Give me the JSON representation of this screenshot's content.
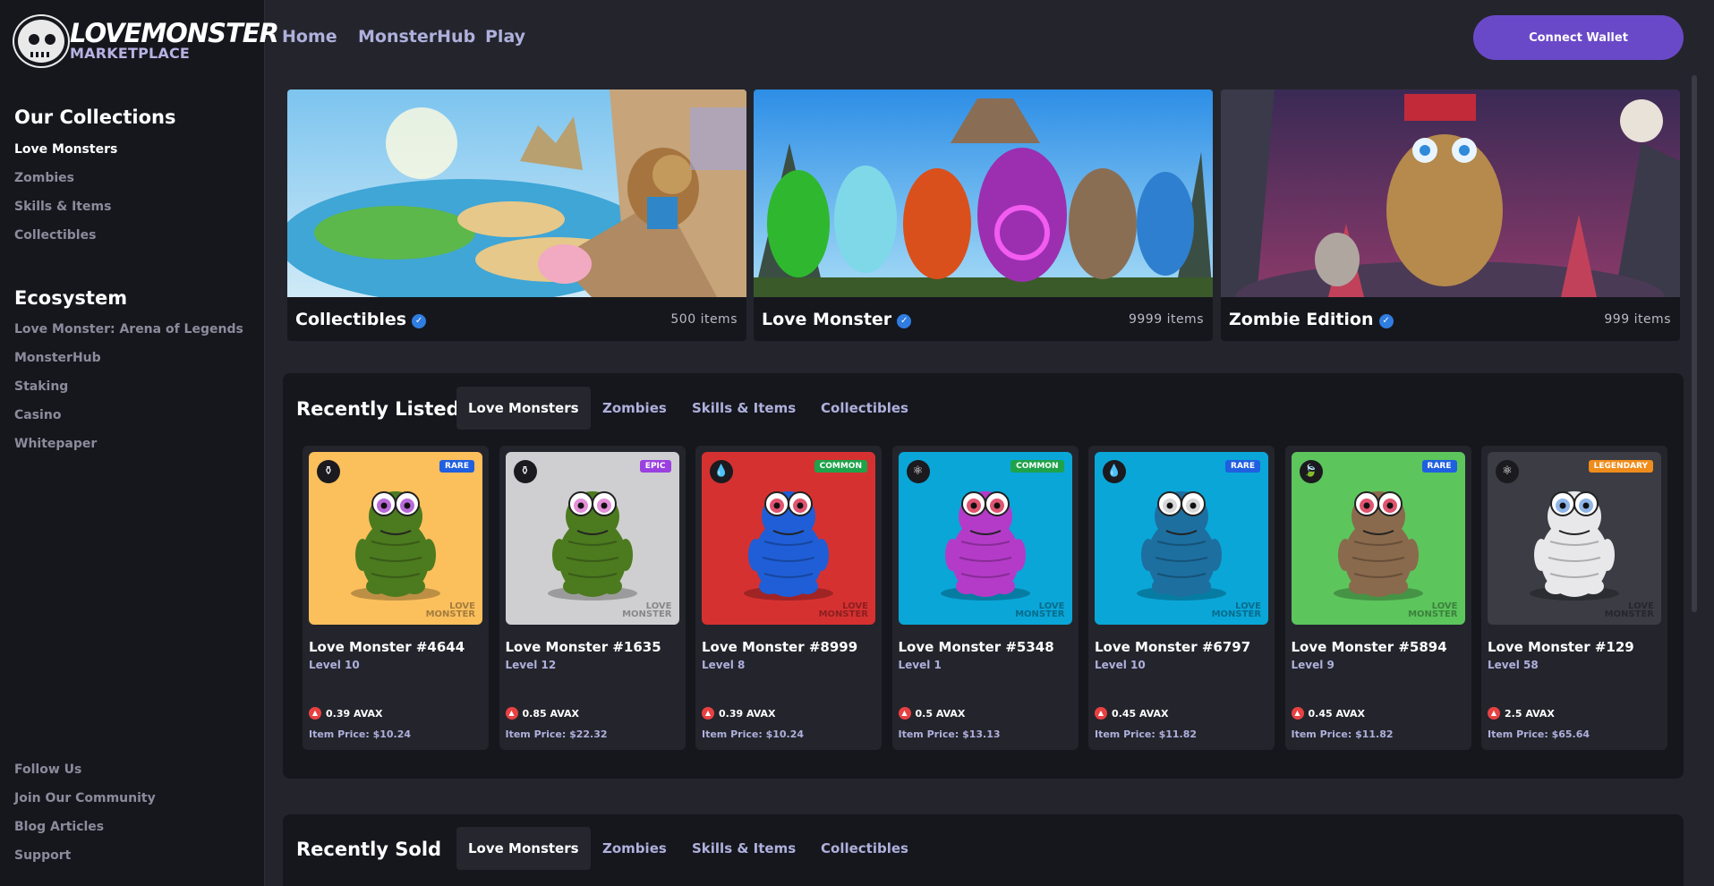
{
  "brand": {
    "line1": "LOVEMONSTER",
    "line2": "MARKETPLACE"
  },
  "sidebar": {
    "collections_heading": "Our Collections",
    "collections": [
      "Love Monsters",
      "Zombies",
      "Skills & Items",
      "Collectibles"
    ],
    "ecosystem_heading": "Ecosystem",
    "ecosystem": [
      "Love Monster: Arena of Legends",
      "MonsterHub",
      "Staking",
      "Casino",
      "Whitepaper"
    ],
    "footer": [
      "Follow Us",
      "Join Our Community",
      "Blog Articles",
      "Support"
    ]
  },
  "nav": {
    "items": [
      "Home",
      "MonsterHub",
      "Play"
    ],
    "wallet": "Connect Wallet"
  },
  "banners": [
    {
      "title": "Collectibles",
      "count": "500 items"
    },
    {
      "title": "Love Monster",
      "count": "9999 items"
    },
    {
      "title": "Zombie Edition",
      "count": "999 items"
    }
  ],
  "recently_listed": {
    "title": "Recently Listed",
    "tabs": [
      "Love Monsters",
      "Zombies",
      "Skills & Items",
      "Collectibles"
    ],
    "cards": [
      {
        "name": "Love Monster #4644",
        "level": "Level 10",
        "price": "0.39 AVAX",
        "item_price": "Item Price: $10.24",
        "rarity": "RARE",
        "bg": "#fbbf5c",
        "rarity_color": "#1f5fe0",
        "body": "#4c7a1f",
        "eyes": "#b86ad8",
        "element_icon": "potion-icon",
        "element_glyph": "⚱"
      },
      {
        "name": "Love Monster #1635",
        "level": "Level 12",
        "price": "0.85 AVAX",
        "item_price": "Item Price: $22.32",
        "rarity": "EPIC",
        "bg": "#cfcfd1",
        "rarity_color": "#9b40e0",
        "body": "#4c7a1f",
        "eyes": "#e490d8",
        "element_icon": "potion-icon",
        "element_glyph": "⚱"
      },
      {
        "name": "Love Monster #8999",
        "level": "Level 8",
        "price": "0.39 AVAX",
        "item_price": "Item Price: $10.24",
        "rarity": "COMMON",
        "bg": "#d63131",
        "rarity_color": "#1fa34a",
        "body": "#1f5ed6",
        "eyes": "#e05470",
        "element_icon": "water-drop-icon",
        "element_glyph": "💧"
      },
      {
        "name": "Love Monster #5348",
        "level": "Level 1",
        "price": "0.5 AVAX",
        "item_price": "Item Price: $13.13",
        "rarity": "COMMON",
        "bg": "#0aa6d8",
        "rarity_color": "#1fa34a",
        "body": "#b43bc8",
        "eyes": "#e05470",
        "element_icon": "atom-icon",
        "element_glyph": "⚛"
      },
      {
        "name": "Love Monster #6797",
        "level": "Level 10",
        "price": "0.45 AVAX",
        "item_price": "Item Price: $11.82",
        "rarity": "RARE",
        "bg": "#0aa6d8",
        "rarity_color": "#1f5fe0",
        "body": "#1d6fa0",
        "eyes": "#d8d8d8",
        "element_icon": "water-drop-icon",
        "element_glyph": "💧"
      },
      {
        "name": "Love Monster #5894",
        "level": "Level 9",
        "price": "0.45 AVAX",
        "item_price": "Item Price: $11.82",
        "rarity": "RARE",
        "bg": "#5cc55c",
        "rarity_color": "#1f5fe0",
        "body": "#8a6a4c",
        "eyes": "#e05470",
        "element_icon": "leaf-icon",
        "element_glyph": "🍃"
      },
      {
        "name": "Love Monster #129",
        "level": "Level 58",
        "price": "2.5 AVAX",
        "item_price": "Item Price: $65.64",
        "rarity": "LEGENDARY",
        "bg": "#3b3c44",
        "rarity_color": "#f08c1a",
        "body": "#e8e8ea",
        "eyes": "#8fb6e8",
        "element_icon": "atom-icon",
        "element_glyph": "⚛"
      }
    ]
  },
  "recently_sold": {
    "title": "Recently Sold",
    "tabs": [
      "Love Monsters",
      "Zombies",
      "Skills & Items",
      "Collectibles"
    ]
  }
}
